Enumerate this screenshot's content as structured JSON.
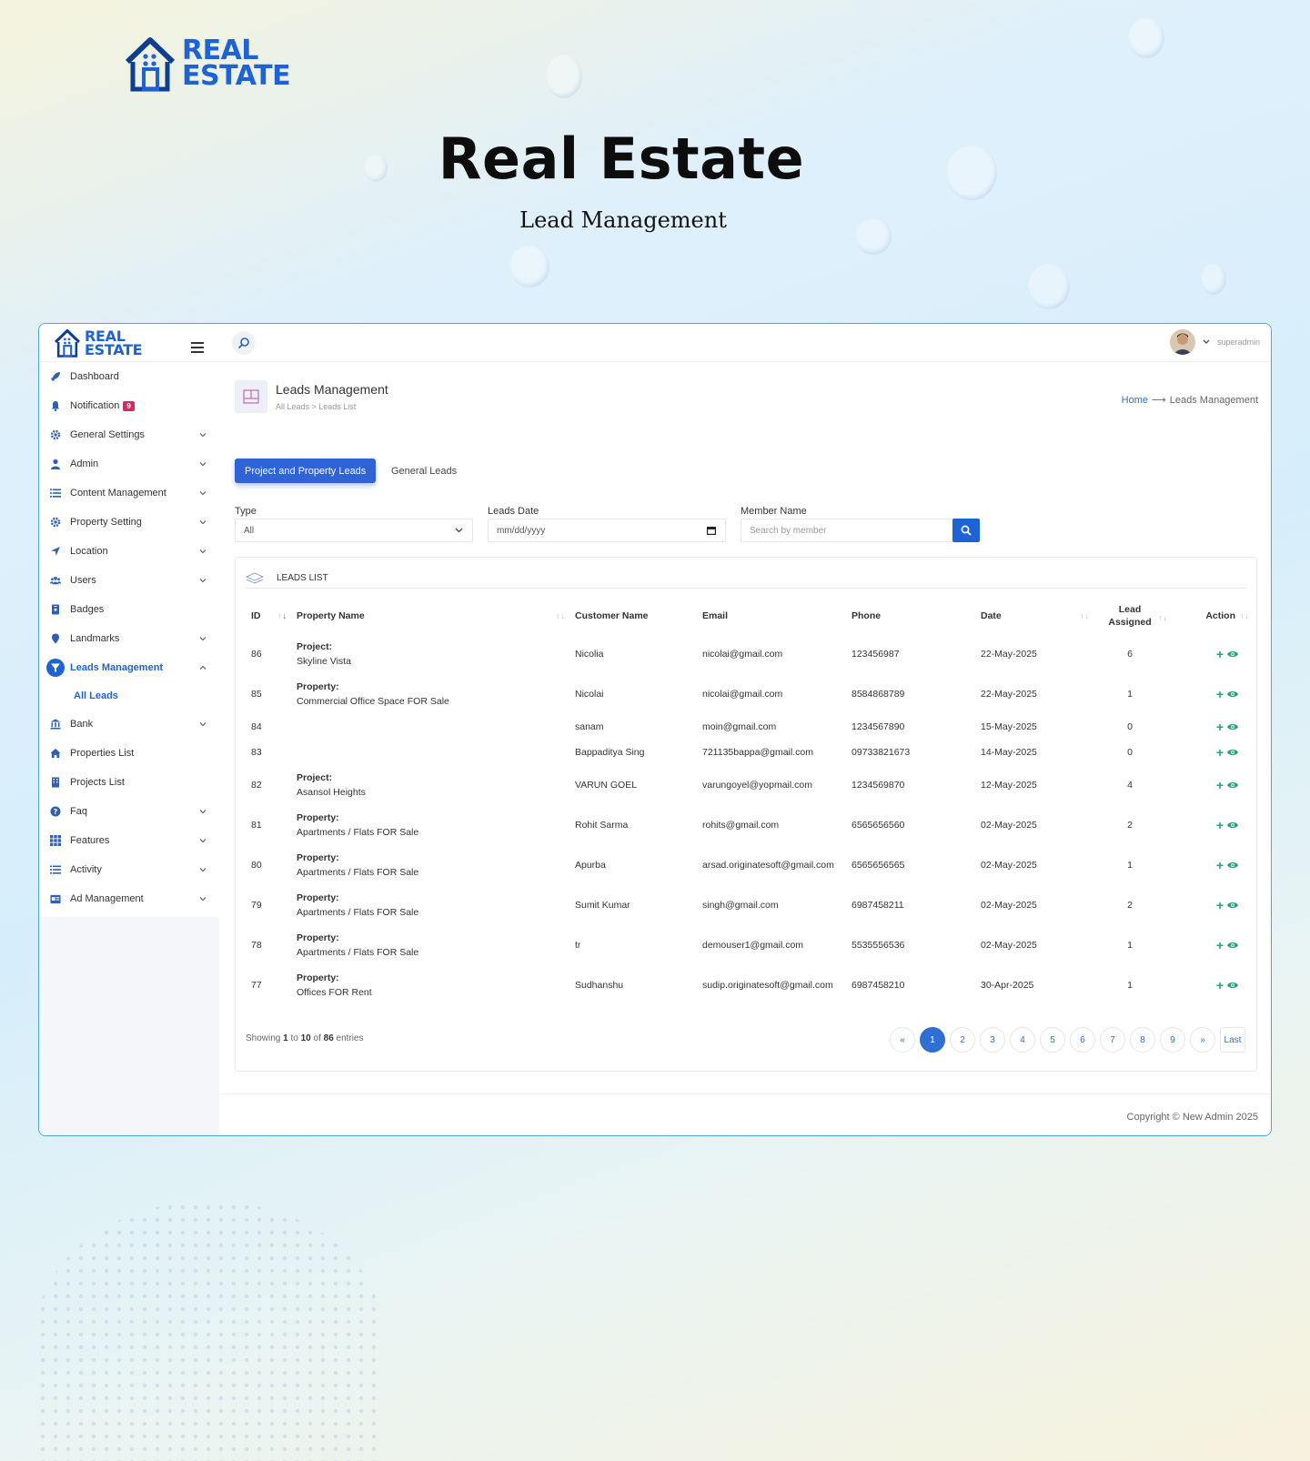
{
  "hero": {
    "logo_line1": "REAL",
    "logo_line2": "ESTATE",
    "title": "Real Estate",
    "subtitle": "Lead Management"
  },
  "app": {
    "logo_line1": "REAL",
    "logo_line2": "ESTATE",
    "user": "superadmin",
    "sidebar": {
      "items": [
        {
          "label": "Dashboard",
          "icon": "rocket-icon",
          "chevron": false
        },
        {
          "label": "Notification",
          "icon": "bell-icon",
          "chevron": false,
          "badge": "9"
        },
        {
          "label": "General Settings",
          "icon": "gear-icon",
          "chevron": true
        },
        {
          "label": "Admin",
          "icon": "user-icon",
          "chevron": true
        },
        {
          "label": "Content Management",
          "icon": "list-icon",
          "chevron": true
        },
        {
          "label": "Property Setting",
          "icon": "gear-icon",
          "chevron": true
        },
        {
          "label": "Location",
          "icon": "location-arrow-icon",
          "chevron": true
        },
        {
          "label": "Users",
          "icon": "users-icon",
          "chevron": true
        },
        {
          "label": "Badges",
          "icon": "badge-icon",
          "chevron": false
        },
        {
          "label": "Landmarks",
          "icon": "map-pin-icon",
          "chevron": true
        },
        {
          "label": "Leads Management",
          "icon": "filter-icon",
          "chevron": true,
          "active": true
        },
        {
          "label": "All Leads",
          "sub": true
        },
        {
          "label": "Bank",
          "icon": "bank-icon",
          "chevron": true
        },
        {
          "label": "Properties List",
          "icon": "home-icon",
          "chevron": false
        },
        {
          "label": "Projects List",
          "icon": "building-icon",
          "chevron": false
        },
        {
          "label": "Faq",
          "icon": "question-icon",
          "chevron": true
        },
        {
          "label": "Features",
          "icon": "grid-icon",
          "chevron": true
        },
        {
          "label": "Activity",
          "icon": "list-icon",
          "chevron": true
        },
        {
          "label": "Ad Management",
          "icon": "ad-icon",
          "chevron": true
        }
      ]
    },
    "page": {
      "title": "Leads Management",
      "crumb": "All Leads > Leads List",
      "bc_home": "Home",
      "bc_arrow": "⟶",
      "bc_current": "Leads Management"
    },
    "tabs": {
      "active": "Project and Property Leads",
      "other": "General Leads"
    },
    "filters": {
      "type_label": "Type",
      "type_value": "All",
      "date_label": "Leads Date",
      "date_value": "mm/dd/yyyy",
      "member_label": "Member Name",
      "member_placeholder": "Search by member"
    },
    "list": {
      "heading": "LEADS LIST",
      "columns": {
        "id": "ID",
        "property": "Property Name",
        "customer": "Customer Name",
        "email": "Email",
        "phone": "Phone",
        "date": "Date",
        "lead_line1": "Lead",
        "lead_line2": "Assigned",
        "action": "Action"
      },
      "rows": [
        {
          "id": "86",
          "ptype": "Project:",
          "pname": "Skyline Vista",
          "customer": "Nicolia",
          "email": "nicolai@gmail.com",
          "phone": "123456987",
          "date": "22-May-2025",
          "assigned": "6"
        },
        {
          "id": "85",
          "ptype": "Property:",
          "pname": "Commercial Office Space FOR Sale",
          "customer": "Nicolai",
          "email": "nicolai@gmail.com",
          "phone": "8584868789",
          "date": "22-May-2025",
          "assigned": "1"
        },
        {
          "id": "84",
          "ptype": "",
          "pname": "",
          "customer": "sanam",
          "email": "moin@gmail.com",
          "phone": "1234567890",
          "date": "15-May-2025",
          "assigned": "0"
        },
        {
          "id": "83",
          "ptype": "",
          "pname": "",
          "customer": "Bappaditya Sing",
          "email": "721135bappa@gmail.com",
          "phone": "09733821673",
          "date": "14-May-2025",
          "assigned": "0"
        },
        {
          "id": "82",
          "ptype": "Project:",
          "pname": "Asansol Heights",
          "customer": "VARUN GOEL",
          "email": "varungoyel@yopmail.com",
          "phone": "1234569870",
          "date": "12-May-2025",
          "assigned": "4"
        },
        {
          "id": "81",
          "ptype": "Property:",
          "pname": "Apartments / Flats FOR Sale",
          "customer": "Rohit Sarma",
          "email": "rohits@gmail.com",
          "phone": "6565656560",
          "date": "02-May-2025",
          "assigned": "2"
        },
        {
          "id": "80",
          "ptype": "Property:",
          "pname": "Apartments / Flats FOR Sale",
          "customer": "Apurba",
          "email": "arsad.originatesoft@gmail.com",
          "phone": "6565656565",
          "date": "02-May-2025",
          "assigned": "1"
        },
        {
          "id": "79",
          "ptype": "Property:",
          "pname": "Apartments / Flats FOR Sale",
          "customer": "Sumit Kumar",
          "email": "singh@gmail.com",
          "phone": "6987458211",
          "date": "02-May-2025",
          "assigned": "2"
        },
        {
          "id": "78",
          "ptype": "Property:",
          "pname": "Apartments / Flats FOR Sale",
          "customer": "tr",
          "email": "demouser1@gmail.com",
          "phone": "5535556536",
          "date": "02-May-2025",
          "assigned": "1"
        },
        {
          "id": "77",
          "ptype": "Property:",
          "pname": "Offices FOR Rent",
          "customer": "Sudhanshu",
          "email": "sudip.originatesoft@gmail.com",
          "phone": "6987458210",
          "date": "30-Apr-2025",
          "assigned": "1"
        }
      ],
      "showing_prefix": "Showing",
      "showing_from": "1",
      "showing_to_word": "to",
      "showing_to": "10",
      "showing_of_word": "of",
      "showing_total": "86",
      "showing_suffix": "entries"
    },
    "pagination": {
      "prev": "«",
      "pages": [
        "1",
        "2",
        "3",
        "4",
        "5",
        "6",
        "7",
        "8",
        "9"
      ],
      "next": "»",
      "last": "Last",
      "current": "1"
    },
    "footer": "Copyright © New Admin 2025",
    "colors": {
      "accent": "#1e63d6",
      "action": "#20a57a",
      "badge": "#e0245e"
    }
  }
}
